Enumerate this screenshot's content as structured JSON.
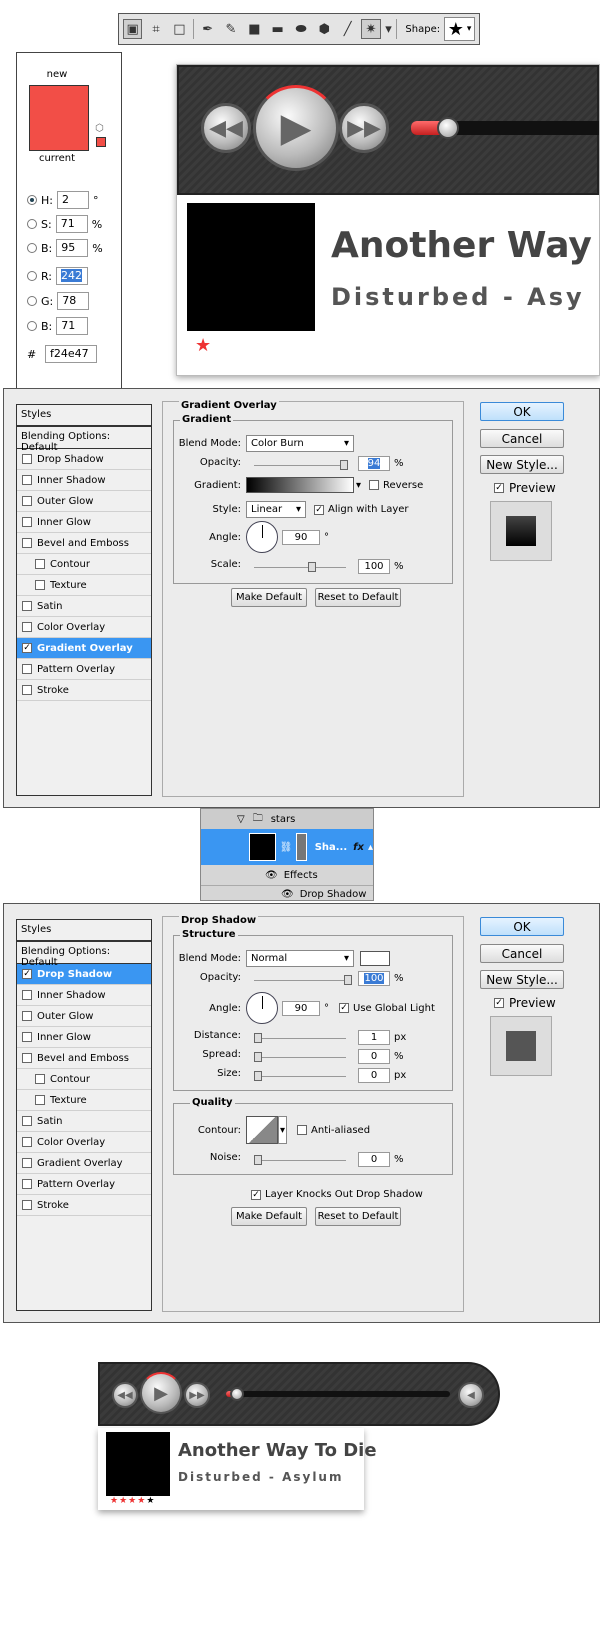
{
  "toolbar": {
    "tools": [
      "marquee-tool",
      "shape-layers-tool",
      "rectangle-tool",
      "pen-tool",
      "freeform-pen-tool",
      "rect-shape",
      "rounded-rect",
      "ellipse",
      "polygon",
      "line",
      "custom-shape"
    ],
    "shape_label": "Shape:",
    "shape_value": "★"
  },
  "color_picker": {
    "new_label": "new",
    "current_label": "current",
    "new_color": "#f24e47",
    "current_color": "#f24e47",
    "h": {
      "label": "H:",
      "value": "2",
      "unit": "°"
    },
    "s": {
      "label": "S:",
      "value": "71",
      "unit": "%"
    },
    "b": {
      "label": "B:",
      "value": "95",
      "unit": "%"
    },
    "r": {
      "label": "R:",
      "value": "242"
    },
    "g": {
      "label": "G:",
      "value": "78"
    },
    "b2": {
      "label": "B:",
      "value": "71"
    },
    "hex_label": "#",
    "hex": "f24e47"
  },
  "player_top": {
    "song": "Another Way T",
    "artist": "Disturbed - Asy",
    "star": "★"
  },
  "dialog1": {
    "styles_header": "Styles",
    "blending": "Blending Options: Default",
    "items": [
      {
        "label": "Drop Shadow",
        "checked": false,
        "indent": false
      },
      {
        "label": "Inner Shadow",
        "checked": false,
        "indent": false
      },
      {
        "label": "Outer Glow",
        "checked": false,
        "indent": false
      },
      {
        "label": "Inner Glow",
        "checked": false,
        "indent": false
      },
      {
        "label": "Bevel and Emboss",
        "checked": false,
        "indent": false
      },
      {
        "label": "Contour",
        "checked": false,
        "indent": true
      },
      {
        "label": "Texture",
        "checked": false,
        "indent": true
      },
      {
        "label": "Satin",
        "checked": false,
        "indent": false
      },
      {
        "label": "Color Overlay",
        "checked": false,
        "indent": false
      },
      {
        "label": "Gradient Overlay",
        "checked": true,
        "indent": false,
        "selected": true
      },
      {
        "label": "Pattern Overlay",
        "checked": false,
        "indent": false
      },
      {
        "label": "Stroke",
        "checked": false,
        "indent": false
      }
    ],
    "panel_title": "Gradient Overlay",
    "group_title": "Gradient",
    "blend_mode_label": "Blend Mode:",
    "blend_mode": "Color Burn",
    "opacity_label": "Opacity:",
    "opacity": "94",
    "percent": "%",
    "gradient_label": "Gradient:",
    "reverse_label": "Reverse",
    "style_label": "Style:",
    "style": "Linear",
    "align_label": "Align with Layer",
    "angle_label": "Angle:",
    "angle": "90",
    "degree": "°",
    "scale_label": "Scale:",
    "scale": "100",
    "make_default": "Make Default",
    "reset_default": "Reset to Default",
    "ok": "OK",
    "cancel": "Cancel",
    "new_style": "New Style...",
    "preview": "Preview"
  },
  "layers": {
    "group": "stars",
    "layer": "Sha...",
    "fx": "fx",
    "effects": "Effects",
    "effect": "Drop Shadow"
  },
  "dialog2": {
    "styles_header": "Styles",
    "blending": "Blending Options: Default",
    "items": [
      {
        "label": "Drop Shadow",
        "checked": true,
        "indent": false,
        "selected": true
      },
      {
        "label": "Inner Shadow",
        "checked": false,
        "indent": false
      },
      {
        "label": "Outer Glow",
        "checked": false,
        "indent": false
      },
      {
        "label": "Inner Glow",
        "checked": false,
        "indent": false
      },
      {
        "label": "Bevel and Emboss",
        "checked": false,
        "indent": false
      },
      {
        "label": "Contour",
        "checked": false,
        "indent": true
      },
      {
        "label": "Texture",
        "checked": false,
        "indent": true
      },
      {
        "label": "Satin",
        "checked": false,
        "indent": false
      },
      {
        "label": "Color Overlay",
        "checked": false,
        "indent": false
      },
      {
        "label": "Gradient Overlay",
        "checked": false,
        "indent": false
      },
      {
        "label": "Pattern Overlay",
        "checked": false,
        "indent": false
      },
      {
        "label": "Stroke",
        "checked": false,
        "indent": false
      }
    ],
    "panel_title": "Drop Shadow",
    "structure_title": "Structure",
    "blend_mode_label": "Blend Mode:",
    "blend_mode": "Normal",
    "opacity_label": "Opacity:",
    "opacity": "100",
    "percent": "%",
    "angle_label": "Angle:",
    "angle": "90",
    "degree": "°",
    "global_light_label": "Use Global Light",
    "distance_label": "Distance:",
    "distance": "1",
    "px": "px",
    "spread_label": "Spread:",
    "spread": "0",
    "size_label": "Size:",
    "size": "0",
    "quality_title": "Quality",
    "contour_label": "Contour:",
    "anti_aliased_label": "Anti-aliased",
    "noise_label": "Noise:",
    "noise": "0",
    "knockout_label": "Layer Knocks Out Drop Shadow",
    "make_default": "Make Default",
    "reset_default": "Reset to Default",
    "ok": "OK",
    "cancel": "Cancel",
    "new_style": "New Style...",
    "preview": "Preview"
  },
  "player_bottom": {
    "song": "Another Way To Die",
    "artist": "Disturbed - Asylum",
    "stars": [
      "★",
      "★",
      "★",
      "★",
      "★"
    ]
  }
}
